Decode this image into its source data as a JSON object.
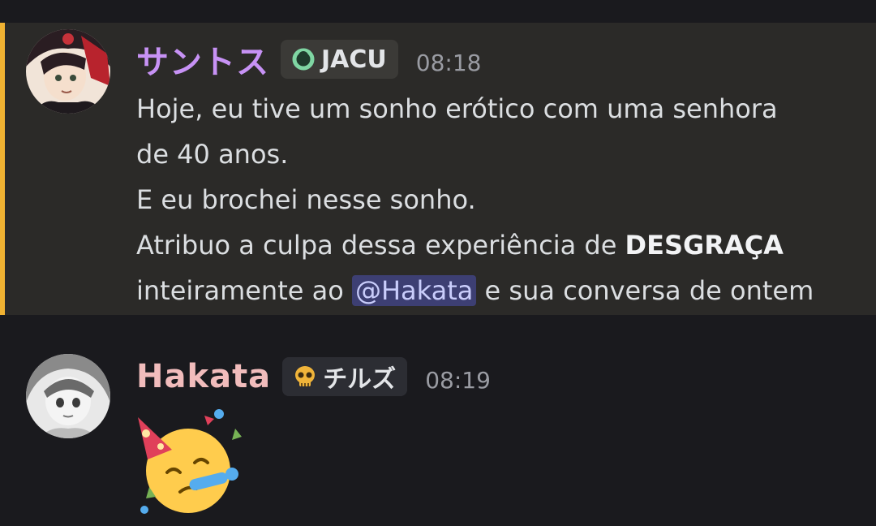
{
  "messages": [
    {
      "username": "サントス",
      "tag": "JACU",
      "tag_icon": "green-ring-icon",
      "timestamp": "08:18",
      "line1": "Hoje, eu tive um sonho erótico com uma senhora",
      "line2": "de 40 anos.",
      "line3": "E eu brochei nesse sonho.",
      "line4_prefix": "Atribuo a culpa dessa experiência de ",
      "line4_bold": "DESGRAÇA",
      "line5_prefix": "inteiramente ao ",
      "mention": "@Hakata",
      "line5_suffix": " e sua conversa de ontem",
      "username_color": "#c792f5",
      "highlight_color": "#f0b232"
    },
    {
      "username": "Hakata",
      "tag": "チルズ",
      "tag_icon": "skull-icon",
      "timestamp": "08:19",
      "emoji": "partying-face-icon",
      "username_color": "#f1bcbc"
    }
  ]
}
